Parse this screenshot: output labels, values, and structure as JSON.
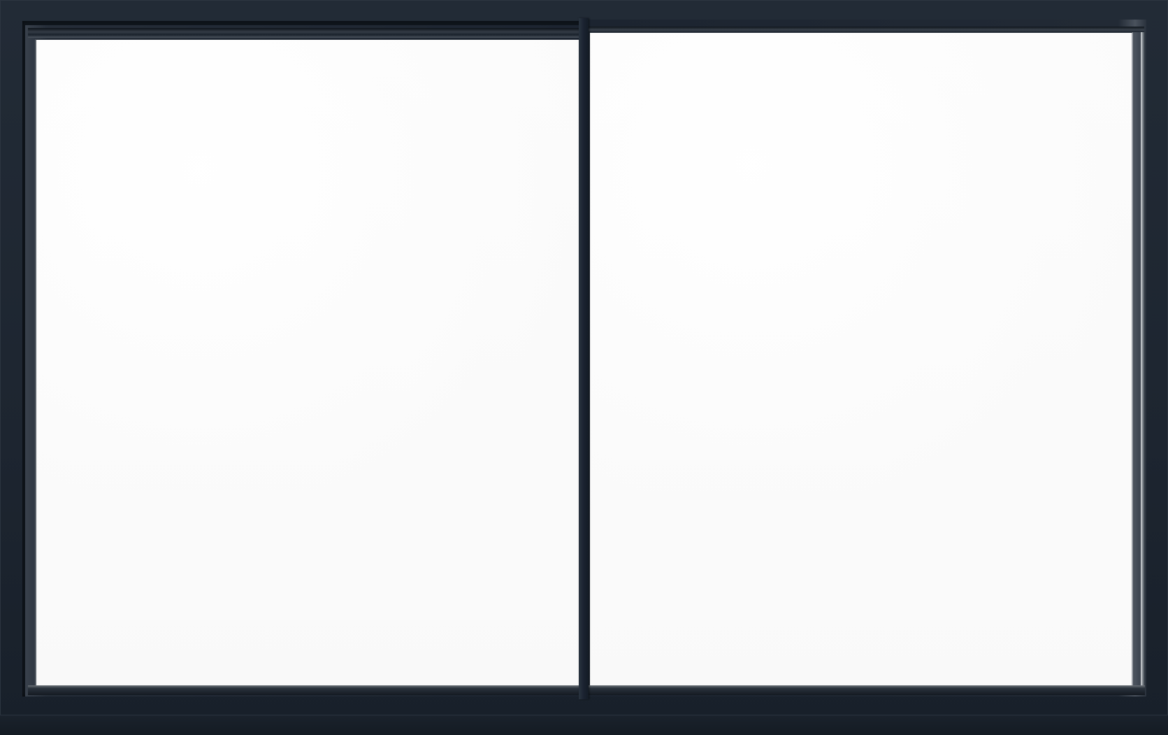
{
  "scene": {
    "subject": "sliding-window",
    "colors": {
      "frame": "#1d2530",
      "glass": "#fbfbfb",
      "rail": "#1a2230"
    }
  }
}
